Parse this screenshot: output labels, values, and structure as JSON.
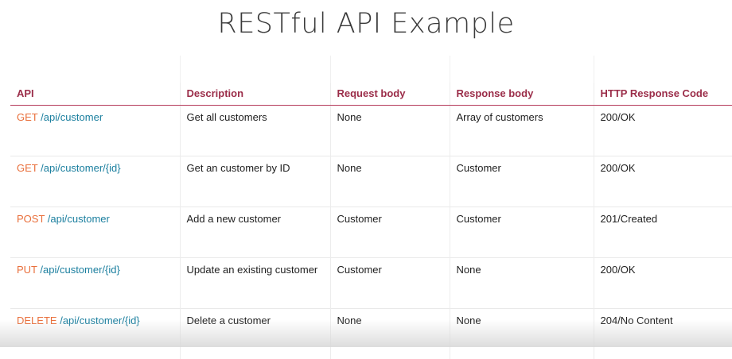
{
  "slide": {
    "title": "RESTful API Example"
  },
  "table": {
    "headers": [
      "API",
      "Description",
      "Request body",
      "Response body",
      "HTTP Response Code"
    ],
    "rows": [
      {
        "method": "GET",
        "path": "/api/customer",
        "description": "Get all customers",
        "request": "None",
        "response": "Array of customers",
        "code": "200/OK"
      },
      {
        "method": "GET",
        "path": "/api/customer/{id}",
        "description": "Get an customer by ID",
        "request": "None",
        "response": "Customer",
        "code": "200/OK"
      },
      {
        "method": "POST",
        "path": "/api/customer",
        "description": "Add a new customer",
        "request": "Customer",
        "response": "Customer",
        "code": "201/Created"
      },
      {
        "method": "PUT",
        "path": "/api/customer/{id}",
        "description": "Update an existing customer",
        "request": "Customer",
        "response": "None",
        "code": "200/OK"
      },
      {
        "method": "DELETE",
        "path": "/api/customer/{id}",
        "description": "Delete a customer",
        "request": "None",
        "response": "None",
        "code": "204/No Content"
      }
    ]
  },
  "colors": {
    "header_text": "#9b2d49",
    "method": "#e96f3b",
    "path": "#1b7f9f"
  }
}
